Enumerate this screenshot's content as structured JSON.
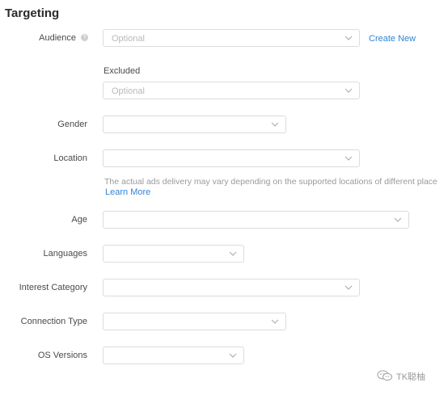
{
  "title": "Targeting",
  "audience": {
    "label": "Audience",
    "placeholder": "Optional",
    "help_icon": "question-icon",
    "create_link": "Create New"
  },
  "excluded": {
    "label": "Excluded",
    "placeholder": "Optional"
  },
  "gender": {
    "label": "Gender",
    "value": ""
  },
  "location": {
    "label": "Location",
    "value": "",
    "note": "The actual ads delivery may vary depending on the supported locations of different place",
    "learn_more": "Learn More"
  },
  "age": {
    "label": "Age",
    "value": ""
  },
  "languages": {
    "label": "Languages",
    "value": ""
  },
  "interest": {
    "label": "Interest Category",
    "value": ""
  },
  "connection": {
    "label": "Connection Type",
    "value": ""
  },
  "os": {
    "label": "OS Versions",
    "value": ""
  },
  "watermark": {
    "text": "TK聪柚",
    "icon": "wechat-icon"
  }
}
